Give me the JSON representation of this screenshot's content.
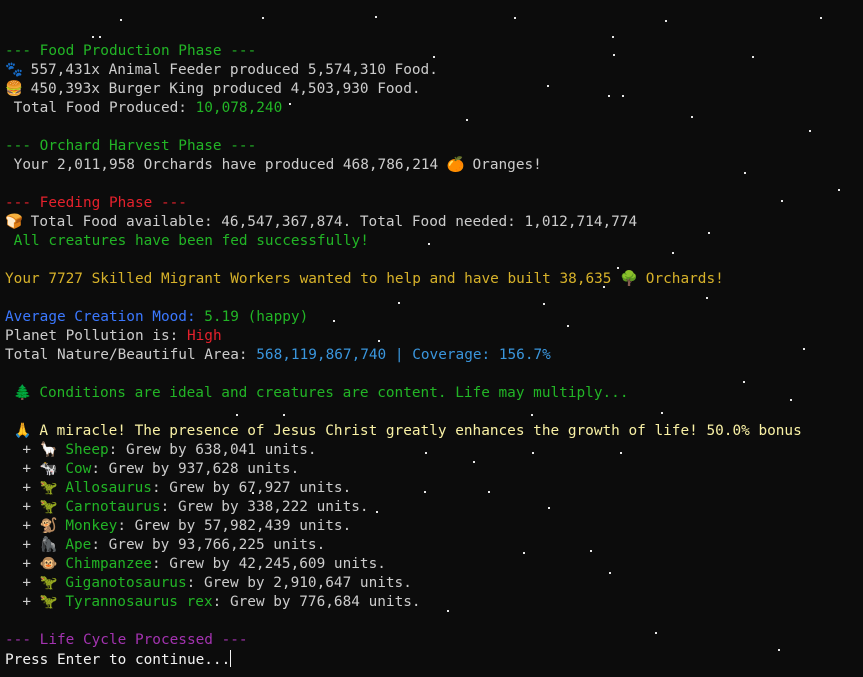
{
  "colors": {
    "background": "#0c0c0c",
    "green": "#22b526",
    "red": "#e5212c",
    "yellow": "#d7b22a",
    "blue": "#3b78ff",
    "light_blue": "#3a96dd",
    "light_yellow": "#f9f1a5",
    "purple": "#a333b0"
  },
  "food": {
    "header": "--- Food Production Phase ---",
    "feeder_icon": "🐾",
    "feeder_text": " 557,431x Animal Feeder produced 5,574,310 Food.",
    "burger_icon": "🍔",
    "burger_text": " 450,393x Burger King produced 4,503,930 Food.",
    "total_label": " Total Food Produced: ",
    "total_value": "10,078,240"
  },
  "orchard": {
    "header": "--- Orchard Harvest Phase ---",
    "text_before": " Your 2,011,958 Orchards have produced 468,786,214 ",
    "orange_icon": "🍊",
    "text_after": " Oranges!"
  },
  "feeding": {
    "header": "--- Feeding Phase ---",
    "bread_icon": "🍞",
    "available_text": " Total Food available: 46,547,367,874. Total Food needed: 1,012,714,774",
    "fed_text": " All creatures have been fed successfully!"
  },
  "migrants": {
    "text_before": "Your 7727 Skilled Migrant Workers wanted to help and have built 38,635 ",
    "tree_icon": "🌳",
    "text_after": " Orchards!"
  },
  "stats": {
    "mood_label": "Average Creation Mood:",
    "mood_value": " 5.19 (happy)",
    "pollution_label": "Planet Pollution is: ",
    "pollution_value": "High",
    "nature_label": "Total Nature/Beautiful Area: ",
    "nature_value": "568,119,867,740 | Coverage: 156.7%"
  },
  "conditions": {
    "tree_icon": "🌲",
    "text": " Conditions are ideal and creatures are content. Life may multiply..."
  },
  "miracle": {
    "pray_icon": "🙏",
    "text": " A miracle! The presence of Jesus Christ greatly enhances the growth of life! 50.0% bonus"
  },
  "growth": [
    {
      "prefix": "  + ",
      "icon": "🦙",
      "name": "Sheep",
      "text": ": Grew by 638,041 units."
    },
    {
      "prefix": "  + ",
      "icon": "🐄",
      "name": "Cow",
      "text": ": Grew by 937,628 units."
    },
    {
      "prefix": "  + ",
      "icon": "🦖",
      "name": "Allosaurus",
      "text": ": Grew by 67,927 units."
    },
    {
      "prefix": "  + ",
      "icon": "🦖",
      "name": "Carnotaurus",
      "text": ": Grew by 338,222 units."
    },
    {
      "prefix": "  + ",
      "icon": "🐒",
      "name": "Monkey",
      "text": ": Grew by 57,982,439 units."
    },
    {
      "prefix": "  + ",
      "icon": "🦍",
      "name": "Ape",
      "text": ": Grew by 93,766,225 units."
    },
    {
      "prefix": "  + ",
      "icon": "🐵",
      "name": "Chimpanzee",
      "text": ": Grew by 42,245,609 units."
    },
    {
      "prefix": "  + ",
      "icon": "🦖",
      "name": "Giganotosaurus",
      "text": ": Grew by 2,910,647 units."
    },
    {
      "prefix": "  + ",
      "icon": "🦖",
      "name": "Tyrannosaurus rex",
      "text": ": Grew by 776,684 units."
    }
  ],
  "lifecycle": {
    "header": "--- Life Cycle Processed ---",
    "prompt": "Press Enter to continue..."
  }
}
